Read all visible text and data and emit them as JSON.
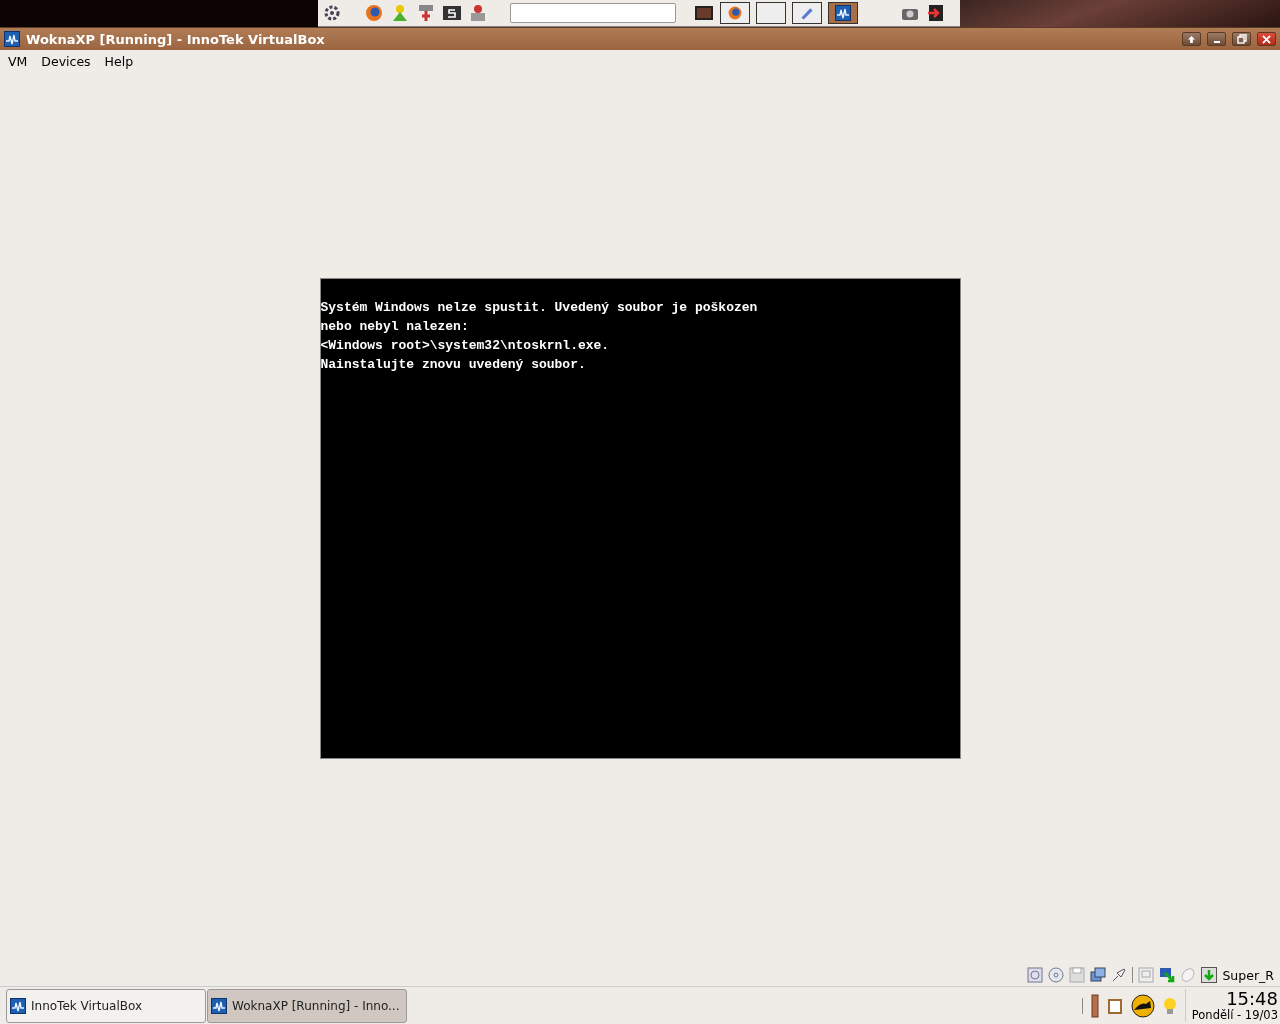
{
  "window": {
    "title": "WoknaXP [Running] - InnoTek VirtualBox"
  },
  "menu": [
    "VM",
    "Devices",
    "Help"
  ],
  "console": {
    "lines": [
      "Systém Windows nelze spustit. Uvedený soubor je poškozen",
      "nebo nebyl nalezen:",
      "<Windows root>\\system32\\ntoskrnl.exe.",
      "Nainstalujte znovu uvedený soubor."
    ]
  },
  "status_bar": {
    "host_key": "Super_R"
  },
  "taskbar": {
    "buttons": [
      {
        "label": "InnoTek VirtualBox",
        "selected": false
      },
      {
        "label": "WoknaXP [Running] - Inno...",
        "selected": true
      }
    ]
  },
  "clock": {
    "time": "15:48",
    "date": "Pondělí - 19/03"
  }
}
